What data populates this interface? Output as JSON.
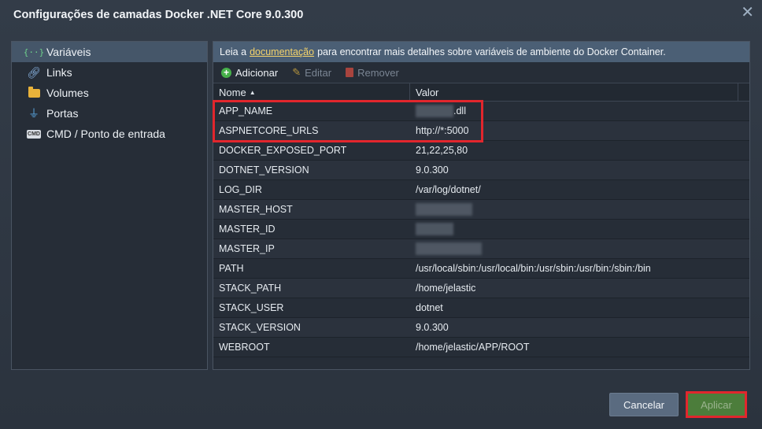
{
  "dialog": {
    "title": "Configurações de camadas Docker .NET Core 9.0.300"
  },
  "sidebar": {
    "items": [
      {
        "label": "Variáveis",
        "icon": "variables-icon"
      },
      {
        "label": "Links",
        "icon": "link-icon"
      },
      {
        "label": "Volumes",
        "icon": "folder-icon"
      },
      {
        "label": "Portas",
        "icon": "usb-icon"
      },
      {
        "label": "CMD / Ponto de entrada",
        "icon": "cmd-icon"
      }
    ]
  },
  "info": {
    "prefix": "Leia a",
    "link": "documentação",
    "suffix": "para encontrar mais detalhes sobre variáveis de ambiente do Docker Container."
  },
  "toolbar": {
    "add": "Adicionar",
    "edit": "Editar",
    "remove": "Remover"
  },
  "table": {
    "columns": [
      "Nome",
      "Valor"
    ],
    "rows": [
      {
        "name": "APP_NAME",
        "value": ".dll"
      },
      {
        "name": "ASPNETCORE_URLS",
        "value": "http://*:5000"
      },
      {
        "name": "DOCKER_EXPOSED_PORT",
        "value": "21,22,25,80"
      },
      {
        "name": "DOTNET_VERSION",
        "value": "9.0.300"
      },
      {
        "name": "LOG_DIR",
        "value": "/var/log/dotnet/"
      },
      {
        "name": "MASTER_HOST",
        "value": ""
      },
      {
        "name": "MASTER_ID",
        "value": ""
      },
      {
        "name": "MASTER_IP",
        "value": ""
      },
      {
        "name": "PATH",
        "value": "/usr/local/sbin:/usr/local/bin:/usr/sbin:/usr/bin:/sbin:/bin"
      },
      {
        "name": "STACK_PATH",
        "value": "/home/jelastic"
      },
      {
        "name": "STACK_USER",
        "value": "dotnet"
      },
      {
        "name": "STACK_VERSION",
        "value": "9.0.300"
      },
      {
        "name": "WEBROOT",
        "value": "/home/jelastic/APP/ROOT"
      }
    ]
  },
  "footer": {
    "cancel": "Cancelar",
    "apply": "Aplicar"
  }
}
